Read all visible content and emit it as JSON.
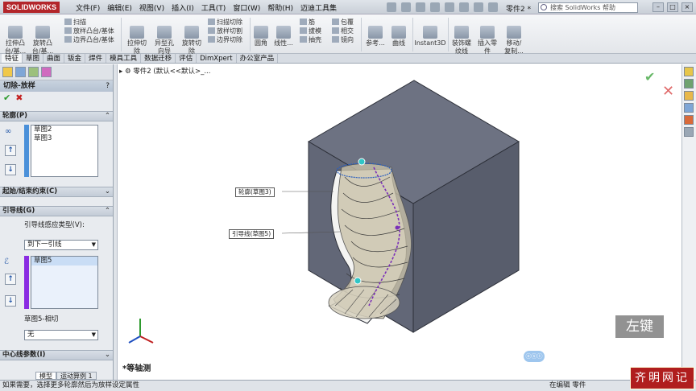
{
  "app": {
    "logo": "SOLIDWORKS",
    "doc_title": "零件2 *",
    "search_placeholder": "搜索 SolidWorks 帮助"
  },
  "menu": [
    "文件(F)",
    "编辑(E)",
    "视图(V)",
    "插入(I)",
    "工具(T)",
    "窗口(W)",
    "帮助(H)",
    "迈迪工具集"
  ],
  "ribbon": {
    "big": [
      {
        "label1": "拉伸凸",
        "label2": "台/基..."
      },
      {
        "label1": "旋转凸",
        "label2": "台/基..."
      },
      {
        "label1": "拉伸切",
        "label2": "除"
      },
      {
        "label1": "异型孔",
        "label2": "向导"
      },
      {
        "label1": "旋转切",
        "label2": "除"
      },
      {
        "label1": "圆角",
        "label2": ""
      },
      {
        "label1": "线性...",
        "label2": ""
      },
      {
        "label1": "参考...",
        "label2": ""
      },
      {
        "label1": "曲线",
        "label2": ""
      },
      {
        "label1": "Instant3D",
        "label2": ""
      },
      {
        "label1": "装饰螺",
        "label2": "纹线"
      },
      {
        "label1": "插入零",
        "label2": "件"
      },
      {
        "label1": "移动/",
        "label2": "复制..."
      }
    ],
    "small_col1": [
      "扫描",
      "放样凸台/基体",
      "边界凸台/基体"
    ],
    "small_col2": [
      "扫描切除",
      "放样切割",
      "边界切除"
    ],
    "small_col3": [
      "筋",
      "拔模",
      "抽壳"
    ],
    "small_col4": [
      "包覆",
      "相交",
      "镜向"
    ]
  },
  "command_tabs": [
    "特征",
    "草图",
    "曲面",
    "钣金",
    "焊件",
    "模具工具",
    "数据迁移",
    "评估",
    "DimXpert",
    "办公室产品"
  ],
  "panel": {
    "title": "切除-放样",
    "help": "?",
    "profiles": {
      "header": "轮廓(P)",
      "items": [
        "草图2",
        "草图3"
      ]
    },
    "start_end": {
      "header": "起始/结束约束(C)"
    },
    "guides": {
      "header": "引导线(G)",
      "influence_label": "引导线感应类型(V):",
      "influence_value": "到下一引线",
      "items": [
        "草图5"
      ],
      "tangency_label": "草图5-相切",
      "tangency_value": "无"
    },
    "centerline": {
      "header": "中心线参数(I)"
    },
    "bottom_tabs": [
      "模型",
      "运动算例 1"
    ]
  },
  "viewport": {
    "tree_path": "零件2 (默认<<默认>_...",
    "callout_profile": "轮廓(草图3)",
    "callout_guide": "引导线(草图5)",
    "view_label": "*等轴测",
    "key_hint": "左键",
    "cursor_badge": "ⓞⓢⓣ",
    "colors": {
      "cube_top": "#6d7282",
      "cube_left": "#656a79",
      "cube_right": "#5b6070",
      "loft_mesh": "#c8c0a8",
      "guide_curve": "#7a2fb8"
    }
  },
  "status": {
    "left": "如果需要，选择更多轮廓然后为放样设定属性",
    "right": "在编辑 零件"
  },
  "watermark": "齐明网记"
}
